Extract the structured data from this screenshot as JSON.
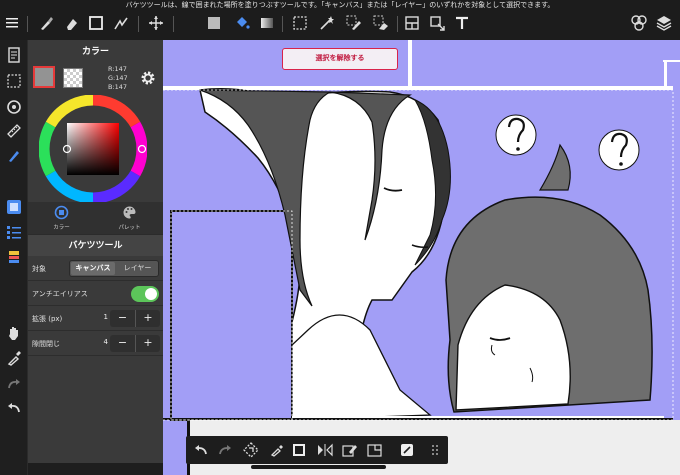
{
  "status_bar": {
    "hint": "バケツツールは、線で囲まれた場所を塗りつぶすツールです。「キャンバス」または「レイヤー」のいずれかを対象として選択できます。"
  },
  "toolbar": {
    "icons": [
      "menu-icon",
      "brush-icon",
      "eraser-icon",
      "square-icon",
      "blur-icon",
      "move-icon",
      "fill-color-icon",
      "bucket-icon",
      "gradient-icon",
      "select-rect-icon",
      "select-wand-icon",
      "select-pen-icon",
      "select-eraser-icon",
      "frame-icon",
      "transform-icon",
      "text-icon",
      "material-icon",
      "layers-icon"
    ]
  },
  "color_panel": {
    "title": "カラー",
    "r": "R:147",
    "g": "G:147",
    "b": "B:147",
    "fg_color": "#939393",
    "tabs": [
      {
        "label": "カラー",
        "icon": "color-circle-icon"
      },
      {
        "label": "パレット",
        "icon": "palette-icon"
      }
    ]
  },
  "bucket_panel": {
    "title": "バケツツール",
    "target_label": "対象",
    "target_options": [
      "キャンバス",
      "レイヤー"
    ],
    "target_selected": "キャンバス",
    "antialias_label": "アンチエイリアス",
    "antialias_on": true,
    "expand_label": "拡張 (px)",
    "expand_value": "1",
    "gap_label": "隙間閉じ",
    "gap_value": "4",
    "minus": "−",
    "plus": "+"
  },
  "canvas": {
    "deselect_label": "選択を解除する",
    "selection_color": "#a29ef6"
  },
  "bottom_toolbar": {
    "icons": [
      "undo-icon",
      "redo-icon",
      "transform-select-icon",
      "eyedropper-icon",
      "stroke-square-icon",
      "flip-icon",
      "clear-icon",
      "canvas-fit-icon",
      "fill-layer-icon",
      "more-icon"
    ]
  }
}
